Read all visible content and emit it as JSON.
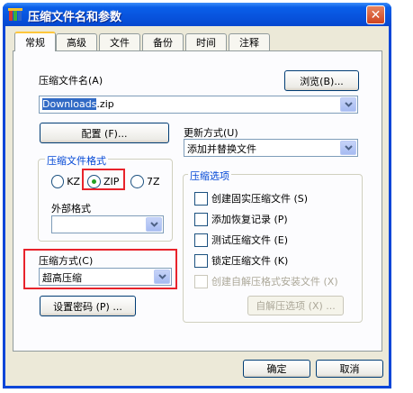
{
  "window": {
    "title": "压缩文件名和参数",
    "close": "✕"
  },
  "tabs": [
    {
      "label": "常规"
    },
    {
      "label": "高级"
    },
    {
      "label": "文件"
    },
    {
      "label": "备份"
    },
    {
      "label": "时间"
    },
    {
      "label": "注释"
    }
  ],
  "archive_name": {
    "label": "压缩文件名(A)",
    "value_selected": "Downloads",
    "value_rest": ".zip",
    "browse": "浏览(B)..."
  },
  "config_button": "配置 (F)...",
  "update_mode": {
    "label": "更新方式(U)",
    "value": "添加并替换文件"
  },
  "archive_format": {
    "title": "压缩文件格式",
    "options": [
      {
        "label": "KZ"
      },
      {
        "label": "ZIP"
      },
      {
        "label": "7Z"
      }
    ],
    "selected": "ZIP",
    "external_label": "外部格式",
    "external_value": ""
  },
  "compression": {
    "label": "压缩方式(C)",
    "value": "超高压缩"
  },
  "password_button": "设置密码 (P) ...",
  "options": {
    "title": "压缩选项",
    "items": [
      {
        "label": "创建固实压缩文件 (S)",
        "enabled": true
      },
      {
        "label": "添加恢复记录 (P)",
        "enabled": true
      },
      {
        "label": "测试压缩文件 (E)",
        "enabled": true
      },
      {
        "label": "锁定压缩文件 (K)",
        "enabled": true
      },
      {
        "label": "创建自解压格式安装文件 (X)",
        "enabled": false
      }
    ],
    "sfx_button": "自解压选项 (X) ..."
  },
  "footer": {
    "ok": "确定",
    "cancel": "取消"
  }
}
